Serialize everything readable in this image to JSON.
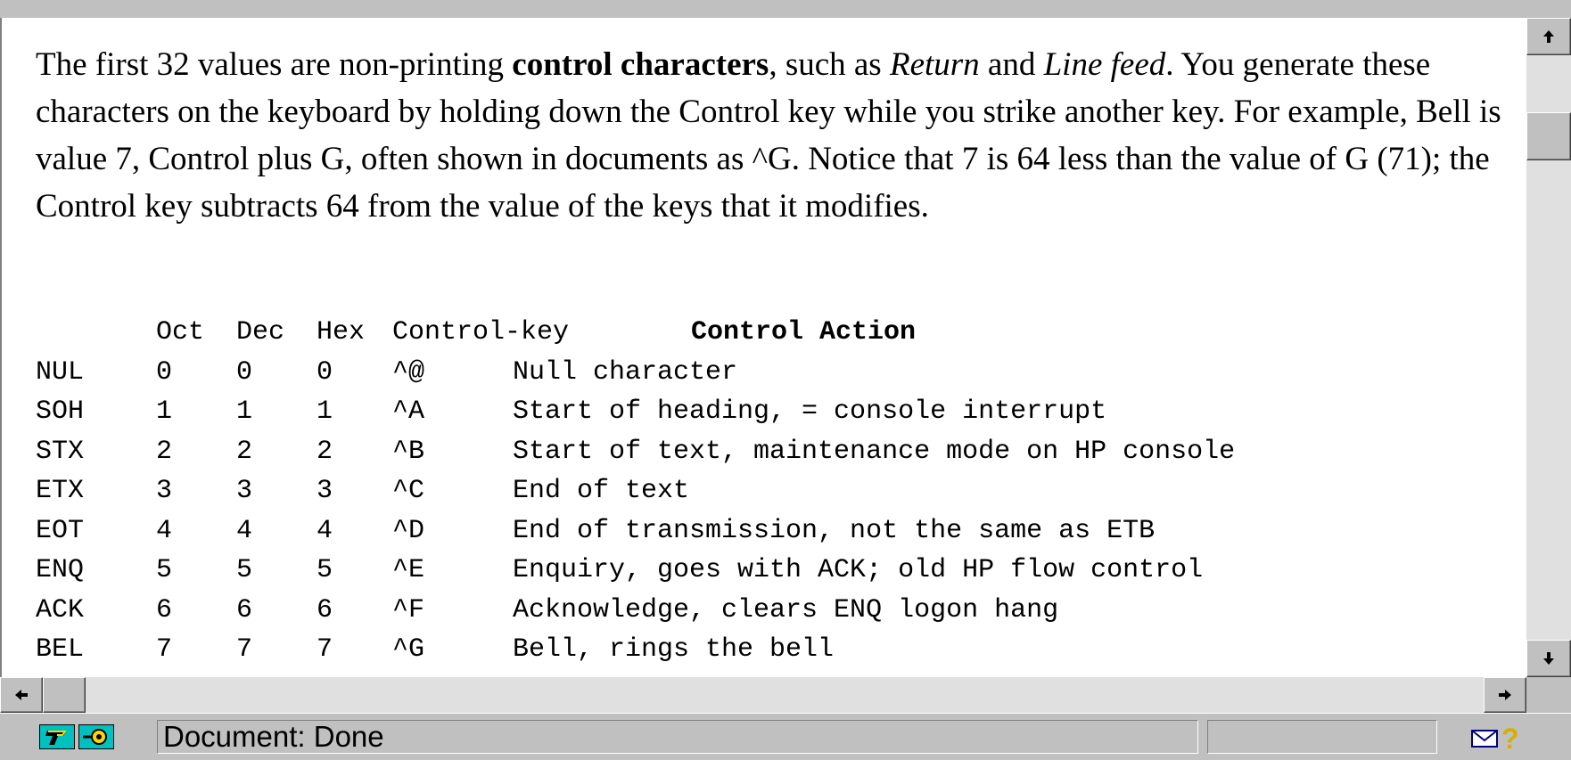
{
  "paragraph": {
    "s1": "The first 32 values are non-printing ",
    "bold1": "control characters",
    "s2": ", such as ",
    "italic1": "Return",
    "s3": " and ",
    "italic2": "Line feed",
    "s4": ". You generate these characters on the keyboard by holding down the Control key while you strike another key. For example, Bell is value 7, Control plus G, often shown in documents as ^G. Notice that 7 is 64 less than the value of G (71); the Control key subtracts 64 from the value of the keys that it modifies."
  },
  "table": {
    "headers": {
      "oct": "Oct",
      "dec": "Dec",
      "hex": "Hex",
      "key": "Control-key",
      "action": "Control Action"
    },
    "rows": [
      {
        "name": "NUL",
        "oct": "0",
        "dec": "0",
        "hex": "0",
        "key": "^@",
        "action": "Null character"
      },
      {
        "name": "SOH",
        "oct": "1",
        "dec": "1",
        "hex": "1",
        "key": "^A",
        "action": "Start of heading, = console interrupt"
      },
      {
        "name": "STX",
        "oct": "2",
        "dec": "2",
        "hex": "2",
        "key": "^B",
        "action": "Start of text, maintenance mode on HP console"
      },
      {
        "name": "ETX",
        "oct": "3",
        "dec": "3",
        "hex": "3",
        "key": "^C",
        "action": "End of text"
      },
      {
        "name": "EOT",
        "oct": "4",
        "dec": "4",
        "hex": "4",
        "key": "^D",
        "action": "End of transmission, not the same as ETB"
      },
      {
        "name": "ENQ",
        "oct": "5",
        "dec": "5",
        "hex": "5",
        "key": "^E",
        "action": "Enquiry, goes with ACK; old HP flow control"
      },
      {
        "name": "ACK",
        "oct": "6",
        "dec": "6",
        "hex": "6",
        "key": "^F",
        "action": "Acknowledge, clears ENQ logon hang"
      },
      {
        "name": "BEL",
        "oct": "7",
        "dec": "7",
        "hex": "7",
        "key": "^G",
        "action": "Bell, rings the bell"
      }
    ]
  },
  "statusbar": {
    "text": "Document: Done",
    "help_glyph": "?"
  },
  "icons": {
    "scroll_up": "up-arrow-icon",
    "scroll_down": "down-arrow-icon",
    "scroll_left": "left-arrow-icon",
    "scroll_right": "right-arrow-icon",
    "security": "security-key-icon",
    "connection": "connection-icon",
    "mail": "mail-icon",
    "help": "help-icon"
  },
  "colors": {
    "chrome": "#c0c0c0",
    "page_bg": "#ffffff",
    "status_icon_bg": "#00c0c0"
  }
}
